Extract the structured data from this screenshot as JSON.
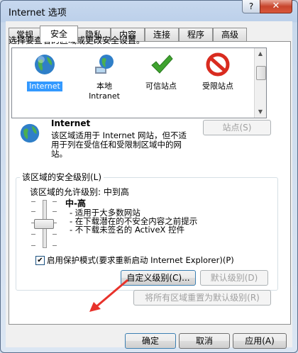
{
  "window": {
    "title": "Internet 选项",
    "help": "?",
    "close": "✕"
  },
  "tabs": [
    {
      "label": "常规"
    },
    {
      "label": "安全"
    },
    {
      "label": "隐私"
    },
    {
      "label": "内容"
    },
    {
      "label": "连接"
    },
    {
      "label": "程序"
    },
    {
      "label": "高级"
    }
  ],
  "active_tab": "安全",
  "instruction": "选择要查看的区域或更改安全设置。",
  "zones": [
    {
      "label": "Internet",
      "icon": "globe-icon",
      "selected": true
    },
    {
      "label": "本地\nIntranet",
      "icon": "intranet-globe-icon"
    },
    {
      "label": "可信站点",
      "icon": "green-check-icon"
    },
    {
      "label": "受限站点",
      "icon": "red-prohibited-icon"
    }
  ],
  "zone_info": {
    "title": "Internet",
    "description": "该区域适用于 Internet 网站，但不适用于列在受信任和受限制区域中的网站。",
    "sites_button": "站点(S)"
  },
  "security_level": {
    "group_label": "该区域的安全级别(L)",
    "allowed_label": "该区域的允许级别: 中到高",
    "level_name": "中-高",
    "bullets": [
      "- 适用于大多数网站",
      "- 在下载潜在的不安全内容之前提示",
      "- 不下载未签名的 ActiveX 控件"
    ],
    "protected_mode_label": "启用保护模式(要求重新启动 Internet Explorer)(P)",
    "protected_mode_checked": true,
    "custom_level_button": "自定义级别(C)...",
    "default_level_button": "默认级别(D)",
    "reset_all_button": "将所有区域重置为默认级别(R)"
  },
  "footer": {
    "ok": "确定",
    "cancel": "取消",
    "apply": "应用(A)"
  },
  "colors": {
    "selection": "#3399ff",
    "annotation_arrow": "#e8322b"
  }
}
